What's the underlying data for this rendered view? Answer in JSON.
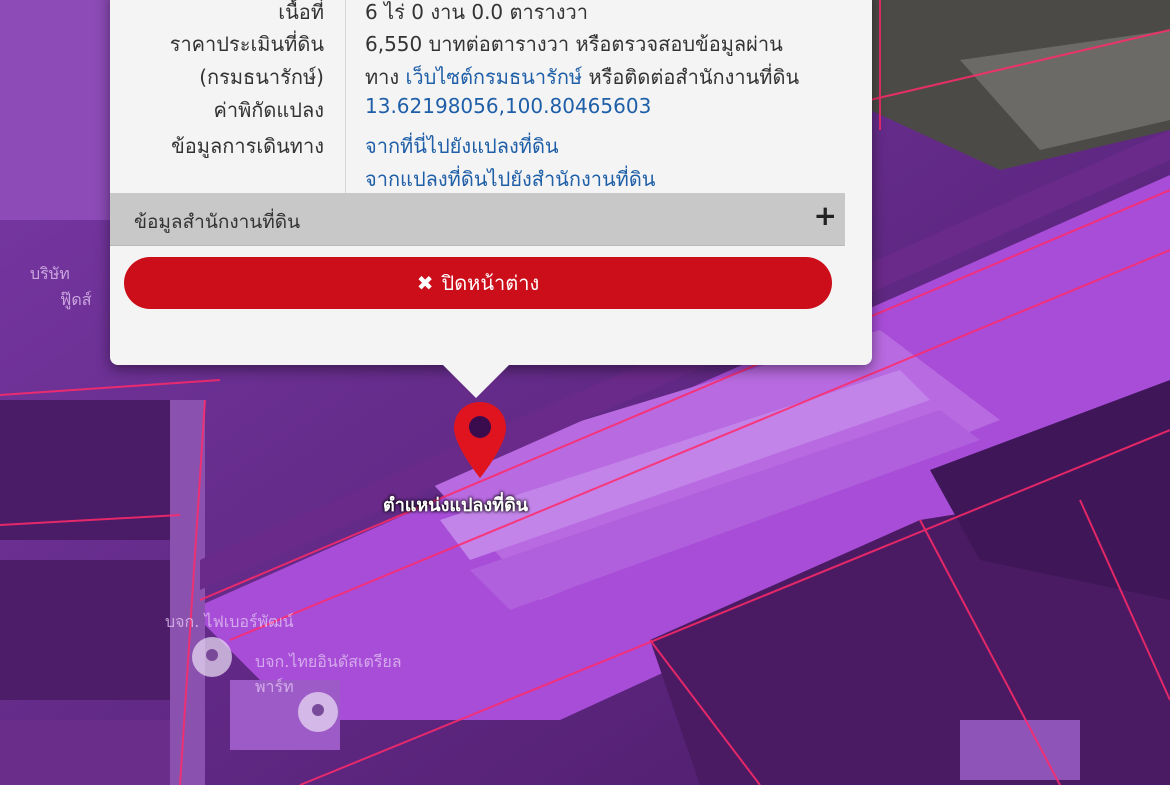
{
  "popup": {
    "rows": [
      {
        "label": "เนื้อที่",
        "value": "6 ไร่ 0 งาน 0.0 ตารางวา"
      },
      {
        "label": "ราคาประเมินที่ดิน",
        "value": "6,550 บาทต่อตารางวา หรือตรวจสอบข้อมูลผ่าน"
      },
      {
        "label": "(กรมธนารักษ์)",
        "value_prefix": "ทาง",
        "value_link": "เว็บไซต์กรมธนารักษ์",
        "value_suffix": "หรือติดต่อสำนักงานที่ดิน"
      },
      {
        "label": "ค่าพิกัดแปลง",
        "value": "13.62198056,100.80465603"
      },
      {
        "label": "ข้อมูลการเดินทาง",
        "value": "จากที่นี่ไปยังแปลงที่ดิน"
      },
      {
        "label": "",
        "value": "จากแปลงที่ดินไปยังสำนักงานที่ดิน"
      }
    ],
    "section_title": "ข้อมูลสำนักงานที่ดิน",
    "section_toggle": "+",
    "close_label": "ปิดหน้าต่าง",
    "close_icon": "✖"
  },
  "map": {
    "marker_label": "ตำแหน่งแปลงที่ดิน",
    "poi_labels": [
      "บจก. ไฟเบอร์พัฒน์",
      "บจก.ไทยอินดัสเตรียล พาร์ท",
      "บริษัท",
      "ฟู๊ดส์"
    ],
    "overlay_color": "#9a2fd0",
    "marker_color": "#e0141e"
  }
}
